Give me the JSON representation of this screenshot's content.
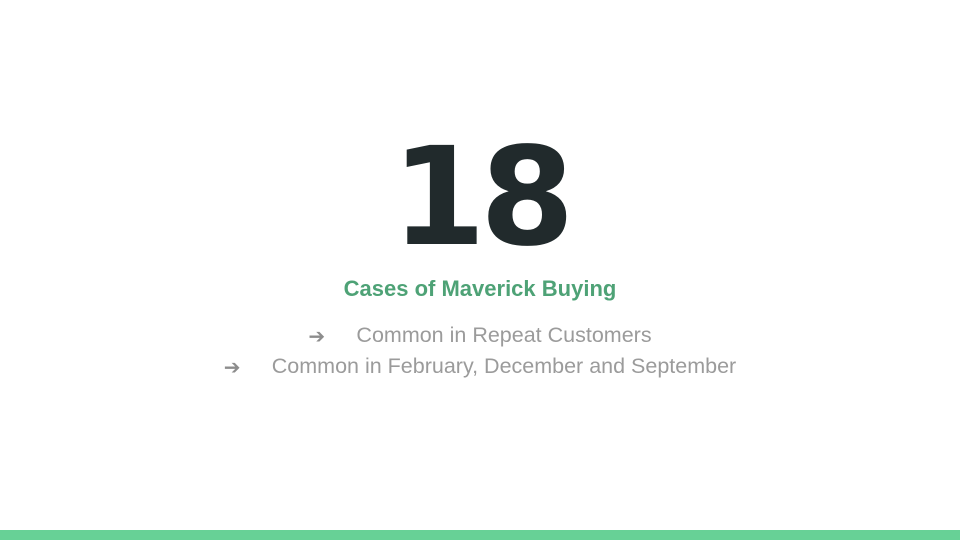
{
  "slide": {
    "big_number": "18",
    "subtitle": "Cases of Maverick Buying",
    "bullets": [
      {
        "icon": "arrow-right-icon",
        "glyph": "➔",
        "text": "Common in Repeat Customers"
      },
      {
        "icon": "arrow-right-icon",
        "glyph": "➔",
        "text": "Common in February, December and September"
      }
    ]
  },
  "colors": {
    "number": "#212a2c",
    "subtitle": "#4ea276",
    "bullet_text": "#9b9b9b",
    "accent_bar": "#67d196",
    "background": "#ffffff"
  }
}
